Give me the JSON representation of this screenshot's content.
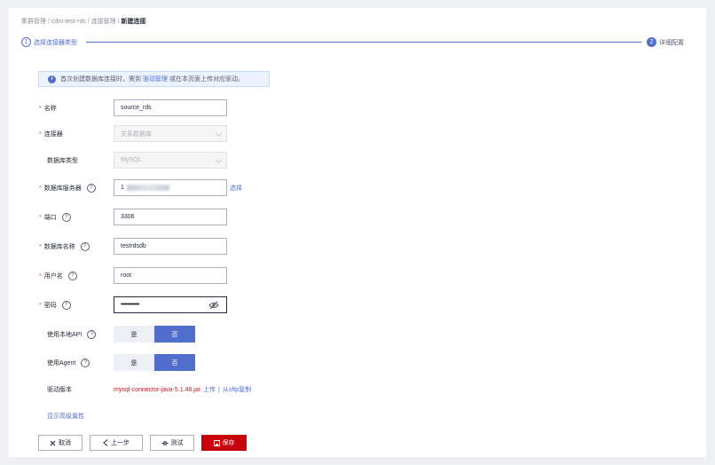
{
  "breadcrumb": {
    "items": [
      "集群管理",
      "cdm-test-rds",
      "连接管理"
    ],
    "separator": "/",
    "current": "新建连接"
  },
  "steps": [
    {
      "num": "1",
      "label": "选择连接器类型"
    },
    {
      "num": "2",
      "label": "详细配置"
    }
  ],
  "info": {
    "icon": "info-icon",
    "text_before": "首次创建数据库连接时，需到",
    "link": "驱动管理",
    "text_after": "或在本页面上传对应驱动。"
  },
  "form": {
    "name": {
      "label": "名称",
      "value": "source_rds"
    },
    "connector": {
      "label": "连接器",
      "value": "关系数据库"
    },
    "db_type": {
      "label": "数据库类型",
      "value": "MySQL"
    },
    "db_server": {
      "label": "数据库服务器",
      "value": "1",
      "select_link": "选择"
    },
    "port": {
      "label": "端口",
      "value": "3306"
    },
    "db_name": {
      "label": "数据库名称",
      "value": "testrdsdb"
    },
    "username": {
      "label": "用户名",
      "value": "root"
    },
    "password": {
      "label": "密码",
      "value": "••••••••••••••"
    },
    "use_local_api": {
      "label": "使用本地API",
      "options": [
        "是",
        "否"
      ],
      "selected": "否"
    },
    "use_agent": {
      "label": "使用Agent",
      "options": [
        "是",
        "否"
      ],
      "selected": "否"
    },
    "driver_version": {
      "label": "驱动版本",
      "value": "mysql-connector-java-5.1.48.jar",
      "upload": "上传",
      "sep": "|",
      "sftp": "从sftp复制"
    }
  },
  "advanced_link": "显示高级属性",
  "buttons": {
    "cancel": "取消",
    "prev": "上一步",
    "test": "测试",
    "save": "保存"
  },
  "colors": {
    "accent": "#526ecc",
    "danger": "#c7000b",
    "required": "#f0384f",
    "driver": "#c4161c"
  }
}
